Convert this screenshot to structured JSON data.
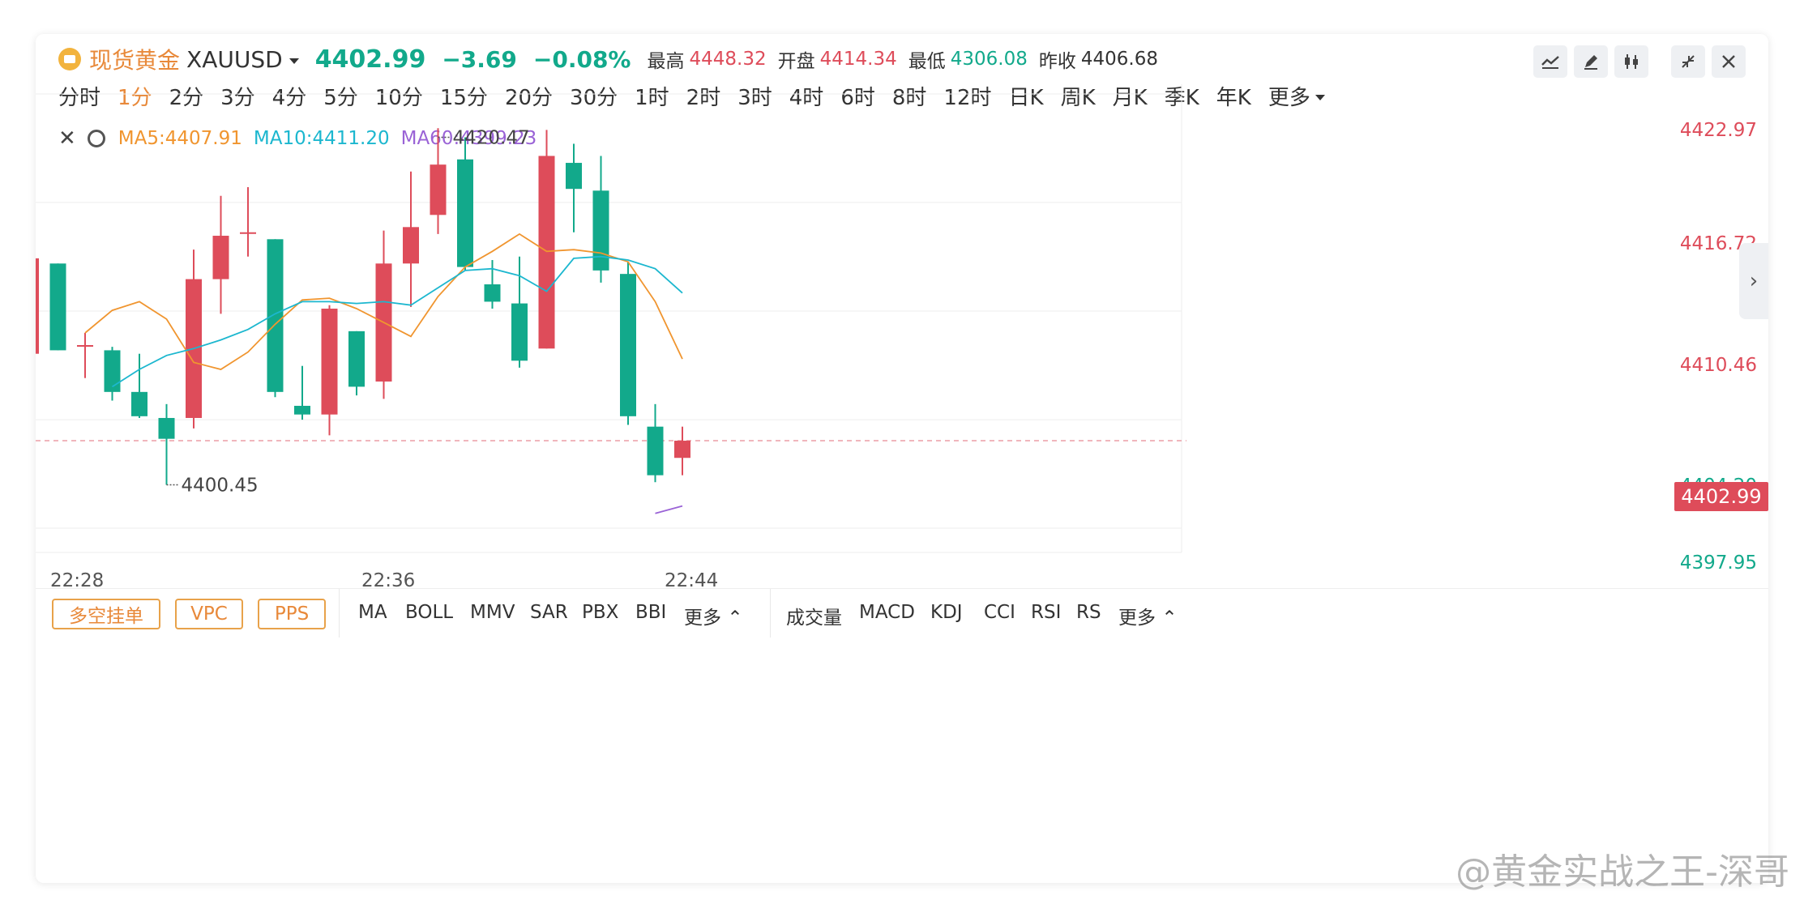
{
  "header": {
    "name": "现货黄金",
    "symbol": "XAUUSD",
    "price": "4402.99",
    "change": "−3.69",
    "change_pct": "−0.08%",
    "stats": [
      {
        "label": "最高",
        "value": "4448.32",
        "color": "#de4c5a"
      },
      {
        "label": "开盘",
        "value": "4414.34",
        "color": "#de4c5a"
      },
      {
        "label": "最低",
        "value": "4306.08",
        "color": "#12a98b"
      },
      {
        "label": "昨收",
        "value": "4406.68",
        "color": "#333333"
      }
    ]
  },
  "toolbar_icons": [
    "line-draw-icon",
    "pencil-icon",
    "candlestick-icon",
    "shrink-icon",
    "close-icon"
  ],
  "timeframes": [
    "分时",
    "1分",
    "2分",
    "3分",
    "4分",
    "5分",
    "10分",
    "15分",
    "20分",
    "30分",
    "1时",
    "2时",
    "3时",
    "4时",
    "6时",
    "8时",
    "12时",
    "日K",
    "周K",
    "月K",
    "季K",
    "年K"
  ],
  "active_timeframe": "1分",
  "more_label": "更多",
  "ma_legend": [
    {
      "label": "MA5:4407.91",
      "color": "#f0952f"
    },
    {
      "label": "MA10:4411.20",
      "color": "#1cb7cf"
    },
    {
      "label": "MA60:4399.23",
      "color": "#9a63d6"
    }
  ],
  "y_axis": {
    "ticks": [
      {
        "value": 4422.97,
        "label": "4422.97",
        "color": "#de4c5a"
      },
      {
        "value": 4416.72,
        "label": "4416.72",
        "color": "#de4c5a"
      },
      {
        "value": 4410.46,
        "label": "4410.46",
        "color": "#de4c5a"
      },
      {
        "value": 4404.2,
        "label": "4404.20",
        "color": "#12a98b"
      },
      {
        "value": 4397.95,
        "label": "4397.95",
        "color": "#12a98b"
      }
    ],
    "current": "4402.99"
  },
  "x_axis": {
    "ticks": [
      "22:28",
      "22:36",
      "22:44"
    ]
  },
  "bottom_bar": {
    "buttons": [
      "多空挂单",
      "VPC",
      "PPS"
    ],
    "main_indicators": [
      "MA",
      "BOLL",
      "MMV",
      "SAR",
      "PBX",
      "BBI"
    ],
    "sub_indicators": [
      "成交量",
      "MACD",
      "KDJ",
      "CCI",
      "RSI",
      "RS"
    ],
    "more": "更多"
  },
  "watermark": "@黄金实战之王-深哥",
  "chart_data": {
    "type": "candlestick",
    "title": "",
    "ylim": [
      4397.95,
      4422.97
    ],
    "up_color": "#de4c5a",
    "down_color": "#12a98b",
    "candles": [
      {
        "o": 4408.0,
        "h": 4413.5,
        "l": 4407.4,
        "c": 4413.5
      },
      {
        "o": 4413.2,
        "h": 4413.2,
        "l": 4408.2,
        "c": 4408.2
      },
      {
        "o": 4408.5,
        "h": 4409.2,
        "l": 4406.6,
        "c": 4408.5
      },
      {
        "o": 4408.2,
        "h": 4408.4,
        "l": 4405.3,
        "c": 4405.8
      },
      {
        "o": 4405.8,
        "h": 4408.0,
        "l": 4404.3,
        "c": 4404.4
      },
      {
        "o": 4404.3,
        "h": 4405.1,
        "l": 4400.45,
        "c": 4403.1
      },
      {
        "o": 4404.3,
        "h": 4414.0,
        "l": 4403.7,
        "c": 4412.3
      },
      {
        "o": 4412.3,
        "h": 4417.1,
        "l": 4410.3,
        "c": 4414.8
      },
      {
        "o": 4415.0,
        "h": 4417.6,
        "l": 4413.6,
        "c": 4415.0
      },
      {
        "o": 4414.6,
        "h": 4414.6,
        "l": 4405.5,
        "c": 4405.8
      },
      {
        "o": 4405.0,
        "h": 4407.3,
        "l": 4404.2,
        "c": 4404.5
      },
      {
        "o": 4404.5,
        "h": 4410.8,
        "l": 4403.3,
        "c": 4410.6
      },
      {
        "o": 4409.3,
        "h": 4409.3,
        "l": 4405.6,
        "c": 4406.1
      },
      {
        "o": 4406.4,
        "h": 4415.1,
        "l": 4405.4,
        "c": 4413.2
      },
      {
        "o": 4413.2,
        "h": 4418.5,
        "l": 4410.7,
        "c": 4415.3
      },
      {
        "o": 4416.0,
        "h": 4421.0,
        "l": 4414.9,
        "c": 4418.9
      },
      {
        "o": 4419.2,
        "h": 4420.47,
        "l": 4412.8,
        "c": 4413.0
      },
      {
        "o": 4412.0,
        "h": 4413.4,
        "l": 4410.6,
        "c": 4411.0
      },
      {
        "o": 4410.9,
        "h": 4413.6,
        "l": 4407.2,
        "c": 4407.6
      },
      {
        "o": 4408.3,
        "h": 4420.9,
        "l": 4408.3,
        "c": 4419.4
      },
      {
        "o": 4419.0,
        "h": 4420.1,
        "l": 4415.0,
        "c": 4417.5
      },
      {
        "o": 4417.4,
        "h": 4419.4,
        "l": 4412.1,
        "c": 4412.8
      },
      {
        "o": 4412.6,
        "h": 4413.3,
        "l": 4403.9,
        "c": 4404.4
      },
      {
        "o": 4403.8,
        "h": 4405.1,
        "l": 4400.6,
        "c": 4401.0
      },
      {
        "o": 4402.0,
        "h": 4403.8,
        "l": 4401.0,
        "c": 4402.99
      }
    ],
    "ma5": [
      4409.2,
      4410.5,
      4411.0,
      4410.0,
      4407.5,
      4407.1,
      4408.1,
      4409.7,
      4411.1,
      4411.2,
      4410.6,
      4409.8,
      4409.0,
      4411.3,
      4413.0,
      4413.9,
      4414.9,
      4413.9,
      4414.0,
      4413.8,
      4413.3,
      4411.0,
      4407.7
    ],
    "ma10": [
      4406.1,
      4407.1,
      4407.9,
      4408.3,
      4408.8,
      4409.4,
      4410.3,
      4411.0,
      4411.0,
      4410.9,
      4411.0,
      4410.8,
      4411.8,
      4412.8,
      4412.9,
      4412.5,
      4411.6,
      4413.5,
      4413.6,
      4413.4,
      4412.9,
      4411.5
    ],
    "ma60": [
      4398.8,
      4399.23
    ],
    "annotations": [
      {
        "label": "4420.47",
        "candle": 15
      },
      {
        "label": "4400.45",
        "candle": 5
      }
    ]
  }
}
